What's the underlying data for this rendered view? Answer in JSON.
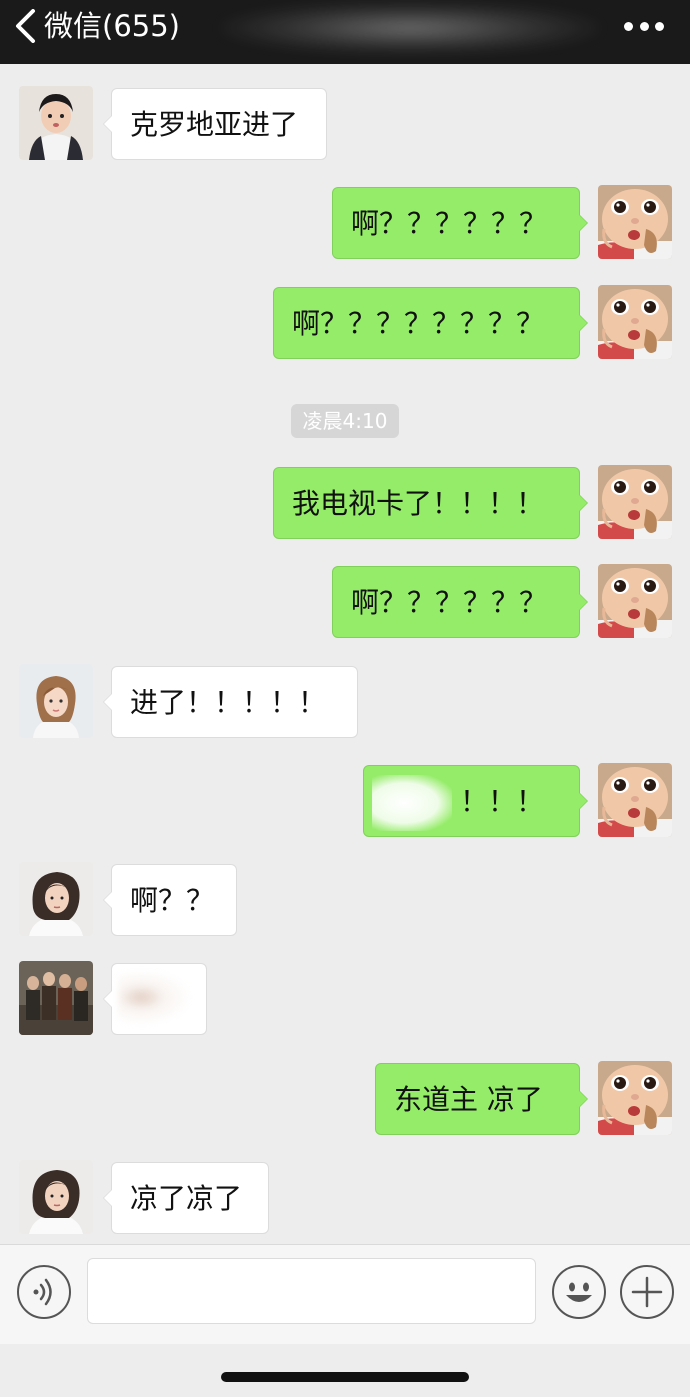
{
  "header": {
    "back_label": "微信(655)"
  },
  "timestamp": "凌晨4:10",
  "messages": [
    {
      "side": "left",
      "text": "克罗地亚进了",
      "avatar": "avatar-girl-kid"
    },
    {
      "side": "right",
      "text": "啊？？？？？？",
      "avatar": "avatar-baby"
    },
    {
      "side": "right",
      "text": "啊？？？？？？？？",
      "avatar": "avatar-baby"
    },
    {
      "side": "right",
      "text": "我电视卡了！！！！",
      "avatar": "avatar-baby"
    },
    {
      "side": "right",
      "text": "啊？？？？？？",
      "avatar": "avatar-baby"
    },
    {
      "side": "left",
      "text": "进了！！！！！",
      "avatar": "avatar-woman"
    },
    {
      "side": "right",
      "text": "！！！",
      "avatar": "avatar-baby"
    },
    {
      "side": "left",
      "text": "啊？？",
      "avatar": "avatar-woman-2"
    },
    {
      "side": "left",
      "text": "",
      "avatar": "avatar-group"
    },
    {
      "side": "right",
      "text": "东道主 凉了",
      "avatar": "avatar-baby"
    },
    {
      "side": "left",
      "text": "凉了凉了",
      "avatar": "avatar-woman-2"
    }
  ],
  "input": {
    "value": "",
    "placeholder": ""
  },
  "icons": {
    "back": "chevron-left-icon",
    "more": "more-dots-icon",
    "voice": "voice-icon",
    "emoji": "emoji-icon",
    "plus": "plus-icon"
  },
  "colors": {
    "header_bg": "#1a1a1a",
    "chat_bg": "#ededed",
    "bubble_self": "#95ec69",
    "bubble_other": "#ffffff"
  }
}
